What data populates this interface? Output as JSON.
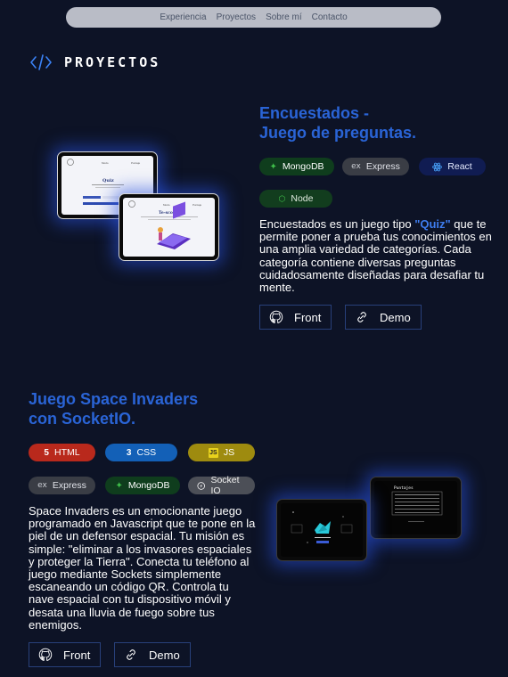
{
  "nav": {
    "items": [
      "Experiencia",
      "Proyectos",
      "Sobre mí",
      "Contacto"
    ]
  },
  "section": {
    "title": "PROYECTOS",
    "icon": "code-icon"
  },
  "projects": [
    {
      "title_line1": "Encuestados -",
      "title_line2": "Juego de preguntas.",
      "tags": [
        "MongoDB",
        "Express",
        "React",
        "Node"
      ],
      "description_before": "Encuestados es un juego tipo ",
      "description_highlight": "\"Quiz\"",
      "description_after": " que te permite poner a prueba tus conocimientos en una amplia variedad de categorías. Cada categoría contiene diversas preguntas cuidadosamente diseñadas para desafiar tu mente.",
      "buttons": {
        "front": "Front",
        "demo": "Demo"
      },
      "mockup_text": {
        "quiz_title": "Quiz",
        "second_title": "Te-score",
        "nav_a": "Modo",
        "nav_b": "Puntaje"
      }
    },
    {
      "title_line1": "Juego Space Invaders",
      "title_line2": "con SocketIO.",
      "tags_row1": [
        "HTML",
        "CSS",
        "JS"
      ],
      "tags_row2": [
        "Express",
        "MongoDB",
        "Socket IO"
      ],
      "description": "Space Invaders es un emocionante juego programado en Javascript que te pone en la piel de un defensor espacial. Tu misión es simple: \"eliminar a los invasores espaciales y proteger la Tierra\". Conecta tu teléfono al juego mediante Sockets simplemente escaneando un código QR. Controla tu nave espacial con tu dispositivo móvil y desata una lluvia de fuego sobre tus enemigos.",
      "buttons": {
        "front": "Front",
        "demo": "Demo"
      },
      "mockup_text": {
        "scores_title": "Puntajes"
      }
    }
  ],
  "colors": {
    "background": "#0d1326",
    "accent_title": "#2a64d6",
    "highlight": "#3e7df0",
    "button_border": "#28407a"
  }
}
